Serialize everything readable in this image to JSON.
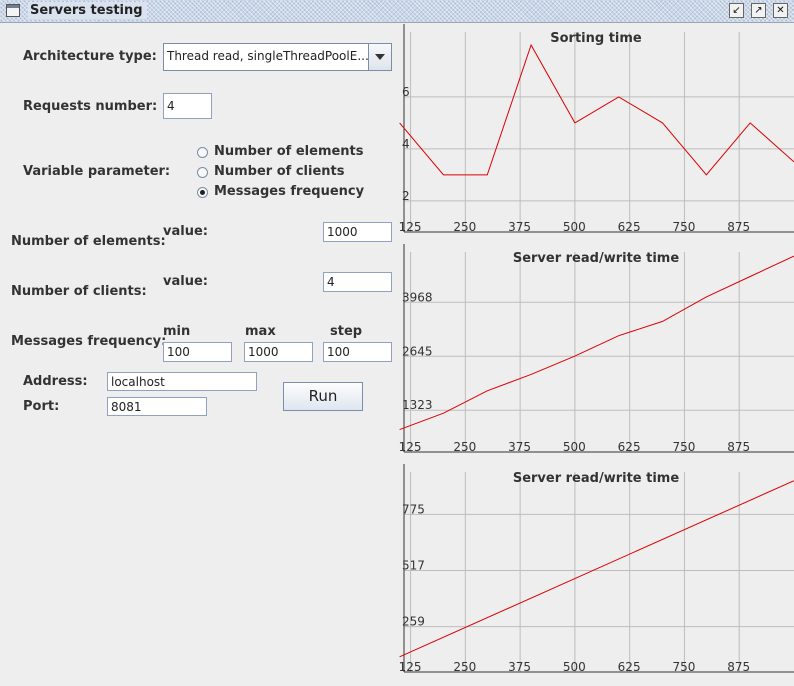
{
  "window": {
    "title": "Servers testing"
  },
  "form": {
    "architecture_label": "Architecture type:",
    "architecture_value": "Thread read, singleThreadPoolE...",
    "requests_label": "Requests number:",
    "requests_value": "4",
    "variable_label": "Variable parameter:",
    "radio_options": [
      {
        "label": "Number of elements",
        "selected": false
      },
      {
        "label": "Number of clients",
        "selected": false
      },
      {
        "label": "Messages frequency",
        "selected": true
      }
    ],
    "elements_label": "Number of elements:",
    "elements_value_label": "value:",
    "elements_value": "1000",
    "clients_label": "Number of clients:",
    "clients_value_label": "value:",
    "clients_value": "4",
    "frequency_label": "Messages frequency:",
    "min_label": "min",
    "max_label": "max",
    "step_label": "step",
    "min_value": "100",
    "max_value": "1000",
    "step_value": "100",
    "address_label": "Address:",
    "address_value": "localhost",
    "port_label": "Port:",
    "port_value": "8081",
    "run_label": "Run"
  },
  "chart_data": [
    {
      "type": "line",
      "title": "Sorting time",
      "x": [
        100,
        200,
        300,
        400,
        500,
        600,
        700,
        800,
        900,
        1000
      ],
      "series": [
        {
          "values": [
            5,
            3,
            3,
            8,
            5,
            6,
            5,
            3,
            5,
            3.5
          ]
        }
      ],
      "xticks": [
        "125",
        "250",
        "375",
        "500",
        "625",
        "750",
        "875"
      ],
      "yticks": [
        "2",
        "4",
        "6"
      ],
      "color": "#dd0000",
      "grid": true
    },
    {
      "type": "line",
      "title": "Server read/write time",
      "x": [
        100,
        200,
        300,
        400,
        500,
        600,
        700,
        800,
        900,
        1000
      ],
      "series": [
        {
          "values": [
            850,
            1250,
            1800,
            2200,
            2650,
            3150,
            3500,
            4100,
            4600,
            5100
          ]
        }
      ],
      "xticks": [
        "125",
        "250",
        "375",
        "500",
        "625",
        "750",
        "875"
      ],
      "yticks": [
        "1323",
        "2645",
        "3968"
      ],
      "color": "#dd0000",
      "grid": true
    },
    {
      "type": "line",
      "title": "Server read/write time",
      "x": [
        100,
        1000
      ],
      "series": [
        {
          "values": [
            120,
            930
          ]
        }
      ],
      "xticks": [
        "125",
        "250",
        "375",
        "500",
        "625",
        "750",
        "875"
      ],
      "yticks": [
        "259",
        "517",
        "775"
      ],
      "color": "#dd0000",
      "grid": true
    }
  ]
}
